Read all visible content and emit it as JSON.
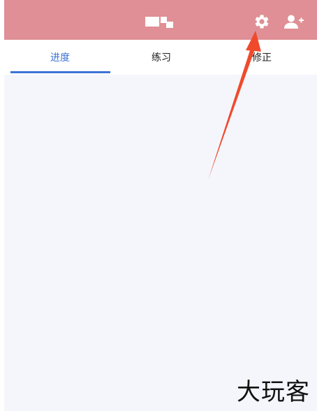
{
  "header": {
    "background_color": "#df8f95",
    "settings_icon": "gear-icon",
    "add_user_icon": "add-user-icon"
  },
  "tabs": [
    {
      "label": "进度",
      "active": true
    },
    {
      "label": "练习",
      "active": false
    },
    {
      "label": "修正",
      "active": false
    }
  ],
  "accent_color": "#3d73d8",
  "annotation_color": "#f04a2d",
  "watermark": "大玩客"
}
